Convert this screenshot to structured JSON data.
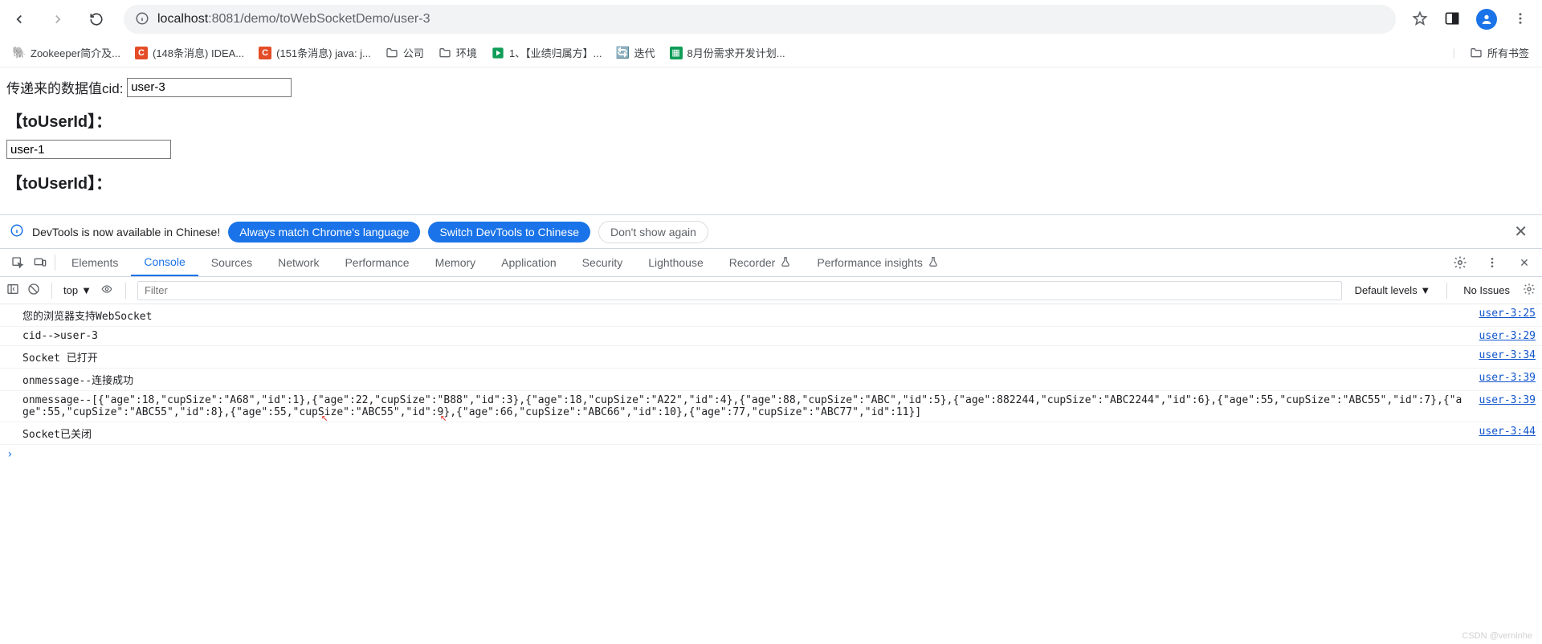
{
  "browser": {
    "url_host": "localhost",
    "url_port": ":8081",
    "url_path": "/demo/toWebSocketDemo/user-3"
  },
  "bookmarks": [
    {
      "icon": "zoo",
      "label": "Zookeeper简介及..."
    },
    {
      "icon": "c",
      "label": "(148条消息) IDEA..."
    },
    {
      "icon": "c",
      "label": "(151条消息) java: j..."
    },
    {
      "icon": "folder",
      "label": "公司"
    },
    {
      "icon": "folder",
      "label": "环境"
    },
    {
      "icon": "play",
      "label": "1、【业绩归属方】..."
    },
    {
      "icon": "iter",
      "label": "迭代"
    },
    {
      "icon": "g",
      "label": "8月份需求开发计划..."
    }
  ],
  "all_bookmarks": "所有书签",
  "page": {
    "cid_label": "传递来的数据值cid:",
    "cid_value": "user-3",
    "to_label1": "【toUserId】：",
    "to_value": "user-1",
    "to_label2": "【toUserId】："
  },
  "devtools_info": {
    "msg": "DevTools is now available in Chinese!",
    "btn_match": "Always match Chrome's language",
    "btn_switch": "Switch DevTools to Chinese",
    "btn_dismiss": "Don't show again"
  },
  "devtools_tabs": [
    "Elements",
    "Console",
    "Sources",
    "Network",
    "Performance",
    "Memory",
    "Application",
    "Security",
    "Lighthouse",
    "Recorder",
    "Performance insights"
  ],
  "console_tb": {
    "context": "top",
    "filter_ph": "Filter",
    "levels": "Default levels",
    "issues": "No Issues"
  },
  "console_lines": [
    {
      "msg": "您的浏览器支持WebSocket",
      "src": "user-3:25"
    },
    {
      "msg": "cid-->user-3",
      "src": "user-3:29"
    },
    {
      "msg": "Socket 已打开",
      "src": "user-3:34"
    },
    {
      "msg": "onmessage--连接成功",
      "src": "user-3:39"
    },
    {
      "msg": "onmessage--[{\"age\":18,\"cupSize\":\"A68\",\"id\":1},{\"age\":22,\"cupSize\":\"B88\",\"id\":3},{\"age\":18,\"cupSize\":\"A22\",\"id\":4},{\"age\":88,\"cupSize\":\"ABC\",\"id\":5},{\"age\":882244,\"cupSize\":\"ABC2244\",\"id\":6},{\"age\":55,\"cupSize\":\"ABC55\",\"id\":7},{\"age\":55,\"cupSize\":\"ABC55\",\"id\":8},{\"age\":55,\"cupSize\":\"ABC55\",\"id\":9},{\"age\":66,\"cupSize\":\"ABC66\",\"id\":10},{\"age\":77,\"cupSize\":\"ABC77\",\"id\":11}]",
      "src": "user-3:39",
      "marks": true
    },
    {
      "msg": "Socket已关闭",
      "src": "user-3:44"
    }
  ],
  "watermark": "CSDN @verninhe"
}
